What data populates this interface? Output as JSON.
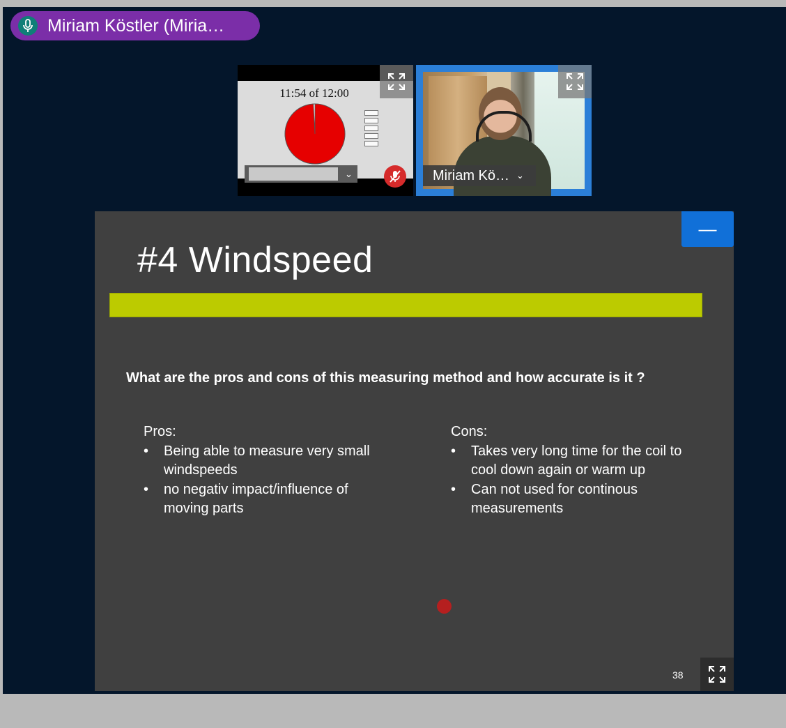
{
  "speaker": {
    "name": "Miriam Köstler (Miria…",
    "icon": "microphone-icon"
  },
  "tiles": {
    "screen_share": {
      "timer_text": "11:54 of 12:00",
      "timer_progress": 0.9917,
      "label_value": "",
      "muted": true
    },
    "camera": {
      "participant_name": "Miriam Kö…"
    }
  },
  "slide": {
    "title": "#4 Windspeed",
    "question": "What are the pros and cons of this measuring method and how accurate is it ?",
    "pros": {
      "heading": "Pros:",
      "items": [
        "Being able to measure very small windspeeds",
        "no negativ impact/influence of moving  parts"
      ]
    },
    "cons": {
      "heading": "Cons:",
      "items": [
        "Takes very long time for the coil to cool down again or warm up",
        "Can not used for continous measurements"
      ]
    },
    "page_number": "38",
    "collapse_label": "—"
  },
  "colors": {
    "background": "#04162b",
    "pill": "#7b2ea8",
    "accent_bar": "#bccb00",
    "slide_bg": "#404040",
    "collapse_button": "#1170d8",
    "mute_red": "#d62b2b"
  }
}
